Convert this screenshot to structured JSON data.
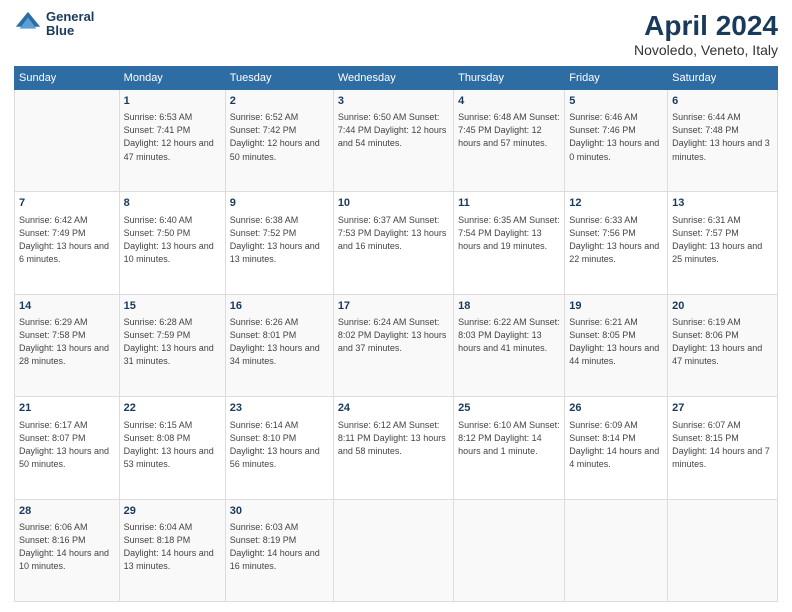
{
  "header": {
    "logo_line1": "General",
    "logo_line2": "Blue",
    "title": "April 2024",
    "subtitle": "Novoledo, Veneto, Italy"
  },
  "days_header": [
    "Sunday",
    "Monday",
    "Tuesday",
    "Wednesday",
    "Thursday",
    "Friday",
    "Saturday"
  ],
  "weeks": [
    [
      {
        "day": "",
        "info": ""
      },
      {
        "day": "1",
        "info": "Sunrise: 6:53 AM\nSunset: 7:41 PM\nDaylight: 12 hours\nand 47 minutes."
      },
      {
        "day": "2",
        "info": "Sunrise: 6:52 AM\nSunset: 7:42 PM\nDaylight: 12 hours\nand 50 minutes."
      },
      {
        "day": "3",
        "info": "Sunrise: 6:50 AM\nSunset: 7:44 PM\nDaylight: 12 hours\nand 54 minutes."
      },
      {
        "day": "4",
        "info": "Sunrise: 6:48 AM\nSunset: 7:45 PM\nDaylight: 12 hours\nand 57 minutes."
      },
      {
        "day": "5",
        "info": "Sunrise: 6:46 AM\nSunset: 7:46 PM\nDaylight: 13 hours\nand 0 minutes."
      },
      {
        "day": "6",
        "info": "Sunrise: 6:44 AM\nSunset: 7:48 PM\nDaylight: 13 hours\nand 3 minutes."
      }
    ],
    [
      {
        "day": "7",
        "info": "Sunrise: 6:42 AM\nSunset: 7:49 PM\nDaylight: 13 hours\nand 6 minutes."
      },
      {
        "day": "8",
        "info": "Sunrise: 6:40 AM\nSunset: 7:50 PM\nDaylight: 13 hours\nand 10 minutes."
      },
      {
        "day": "9",
        "info": "Sunrise: 6:38 AM\nSunset: 7:52 PM\nDaylight: 13 hours\nand 13 minutes."
      },
      {
        "day": "10",
        "info": "Sunrise: 6:37 AM\nSunset: 7:53 PM\nDaylight: 13 hours\nand 16 minutes."
      },
      {
        "day": "11",
        "info": "Sunrise: 6:35 AM\nSunset: 7:54 PM\nDaylight: 13 hours\nand 19 minutes."
      },
      {
        "day": "12",
        "info": "Sunrise: 6:33 AM\nSunset: 7:56 PM\nDaylight: 13 hours\nand 22 minutes."
      },
      {
        "day": "13",
        "info": "Sunrise: 6:31 AM\nSunset: 7:57 PM\nDaylight: 13 hours\nand 25 minutes."
      }
    ],
    [
      {
        "day": "14",
        "info": "Sunrise: 6:29 AM\nSunset: 7:58 PM\nDaylight: 13 hours\nand 28 minutes."
      },
      {
        "day": "15",
        "info": "Sunrise: 6:28 AM\nSunset: 7:59 PM\nDaylight: 13 hours\nand 31 minutes."
      },
      {
        "day": "16",
        "info": "Sunrise: 6:26 AM\nSunset: 8:01 PM\nDaylight: 13 hours\nand 34 minutes."
      },
      {
        "day": "17",
        "info": "Sunrise: 6:24 AM\nSunset: 8:02 PM\nDaylight: 13 hours\nand 37 minutes."
      },
      {
        "day": "18",
        "info": "Sunrise: 6:22 AM\nSunset: 8:03 PM\nDaylight: 13 hours\nand 41 minutes."
      },
      {
        "day": "19",
        "info": "Sunrise: 6:21 AM\nSunset: 8:05 PM\nDaylight: 13 hours\nand 44 minutes."
      },
      {
        "day": "20",
        "info": "Sunrise: 6:19 AM\nSunset: 8:06 PM\nDaylight: 13 hours\nand 47 minutes."
      }
    ],
    [
      {
        "day": "21",
        "info": "Sunrise: 6:17 AM\nSunset: 8:07 PM\nDaylight: 13 hours\nand 50 minutes."
      },
      {
        "day": "22",
        "info": "Sunrise: 6:15 AM\nSunset: 8:08 PM\nDaylight: 13 hours\nand 53 minutes."
      },
      {
        "day": "23",
        "info": "Sunrise: 6:14 AM\nSunset: 8:10 PM\nDaylight: 13 hours\nand 56 minutes."
      },
      {
        "day": "24",
        "info": "Sunrise: 6:12 AM\nSunset: 8:11 PM\nDaylight: 13 hours\nand 58 minutes."
      },
      {
        "day": "25",
        "info": "Sunrise: 6:10 AM\nSunset: 8:12 PM\nDaylight: 14 hours\nand 1 minute."
      },
      {
        "day": "26",
        "info": "Sunrise: 6:09 AM\nSunset: 8:14 PM\nDaylight: 14 hours\nand 4 minutes."
      },
      {
        "day": "27",
        "info": "Sunrise: 6:07 AM\nSunset: 8:15 PM\nDaylight: 14 hours\nand 7 minutes."
      }
    ],
    [
      {
        "day": "28",
        "info": "Sunrise: 6:06 AM\nSunset: 8:16 PM\nDaylight: 14 hours\nand 10 minutes."
      },
      {
        "day": "29",
        "info": "Sunrise: 6:04 AM\nSunset: 8:18 PM\nDaylight: 14 hours\nand 13 minutes."
      },
      {
        "day": "30",
        "info": "Sunrise: 6:03 AM\nSunset: 8:19 PM\nDaylight: 14 hours\nand 16 minutes."
      },
      {
        "day": "",
        "info": ""
      },
      {
        "day": "",
        "info": ""
      },
      {
        "day": "",
        "info": ""
      },
      {
        "day": "",
        "info": ""
      }
    ]
  ]
}
